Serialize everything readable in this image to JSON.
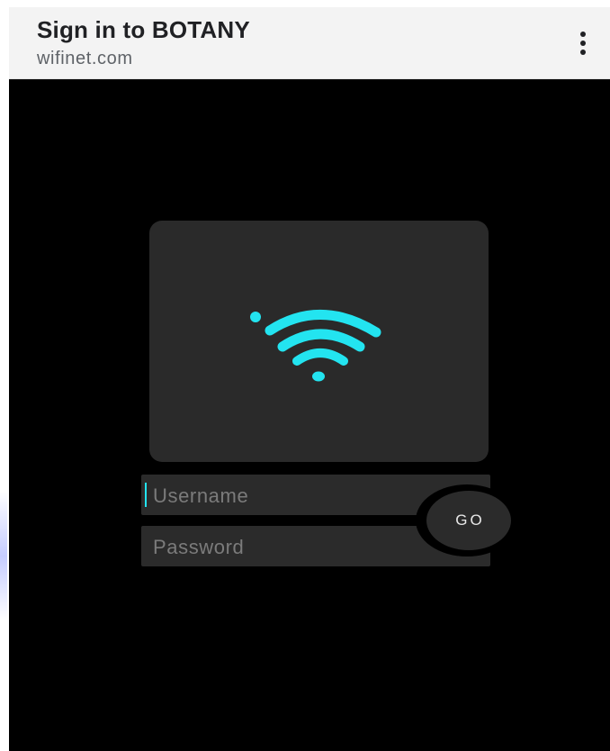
{
  "header": {
    "title": "Sign in to BOTANY",
    "url": "wifinet.com",
    "menu_icon": "vertical-ellipsis-icon"
  },
  "logo": {
    "icon": "wifi-icon",
    "accent_color": "#23e4f0"
  },
  "form": {
    "username_placeholder": "Username",
    "username_value": "",
    "password_placeholder": "Password",
    "password_value": "",
    "go_label": "GO"
  },
  "colors": {
    "background": "#000000",
    "card": "#2a2a2a",
    "field": "#2b2b2b",
    "header_bg": "#f3f3f3",
    "accent": "#23e4f0"
  }
}
